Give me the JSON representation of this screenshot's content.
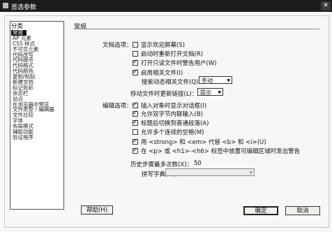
{
  "window": {
    "title": "首选参数",
    "close_glyph": "✕"
  },
  "left": {
    "header": "分类",
    "items": [
      "常规",
      "AP 元素",
      "CSS 样式",
      "不可见元素",
      "代码改写",
      "代码提示",
      "代码格式",
      "代码颜色",
      "复制/粘贴",
      "新建文档",
      "标记色彩",
      "状态栏",
      "站点",
      "在浏览器中预览",
      "文件类型 / 编辑器",
      "文件比较",
      "字体",
      "布局模式",
      "辅助功能",
      "验证程序"
    ]
  },
  "main": {
    "section_title": "常规",
    "doc_options_label": "文档选项：",
    "doc_opts": [
      {
        "label": "显示欢迎屏幕(S)",
        "checked": false
      },
      {
        "label": "启动时重新打开文档(R)",
        "checked": false
      },
      {
        "label": "打开只读文件时警告用户(W)",
        "checked": true
      },
      {
        "label": "启用相关文件(I)",
        "checked": true
      }
    ],
    "discover_label": "搜索动态相关文件(Q)：",
    "discover_value": "手动",
    "move_label": "移动文件时更新链接(L)：",
    "move_value": "提示",
    "edit_options_label": "编辑选项：",
    "edit_opts": [
      {
        "label": "插入对象时显示对话框(I)",
        "checked": true
      },
      {
        "label": "允许双字节内联输入(B)",
        "checked": true
      },
      {
        "label": "标题后切换到普通段落(A)",
        "checked": true
      },
      {
        "label": "允许多个连续的空格(M)",
        "checked": false
      },
      {
        "label": "用 <strong> 和 <em> 代替 <b> 和 <i>(U)",
        "checked": true
      },
      {
        "label": "在 <p> 或 <h1>-<h6> 标签中放置可编辑区域时发出警告",
        "checked": true
      }
    ],
    "history_label": "历史步骤最多次数(X)：",
    "history_value": "50",
    "spell_label": "拼写字典(G)：",
    "spell_value": ""
  },
  "buttons": {
    "help": "帮助(H)",
    "ok": "确定",
    "cancel": "取消"
  }
}
